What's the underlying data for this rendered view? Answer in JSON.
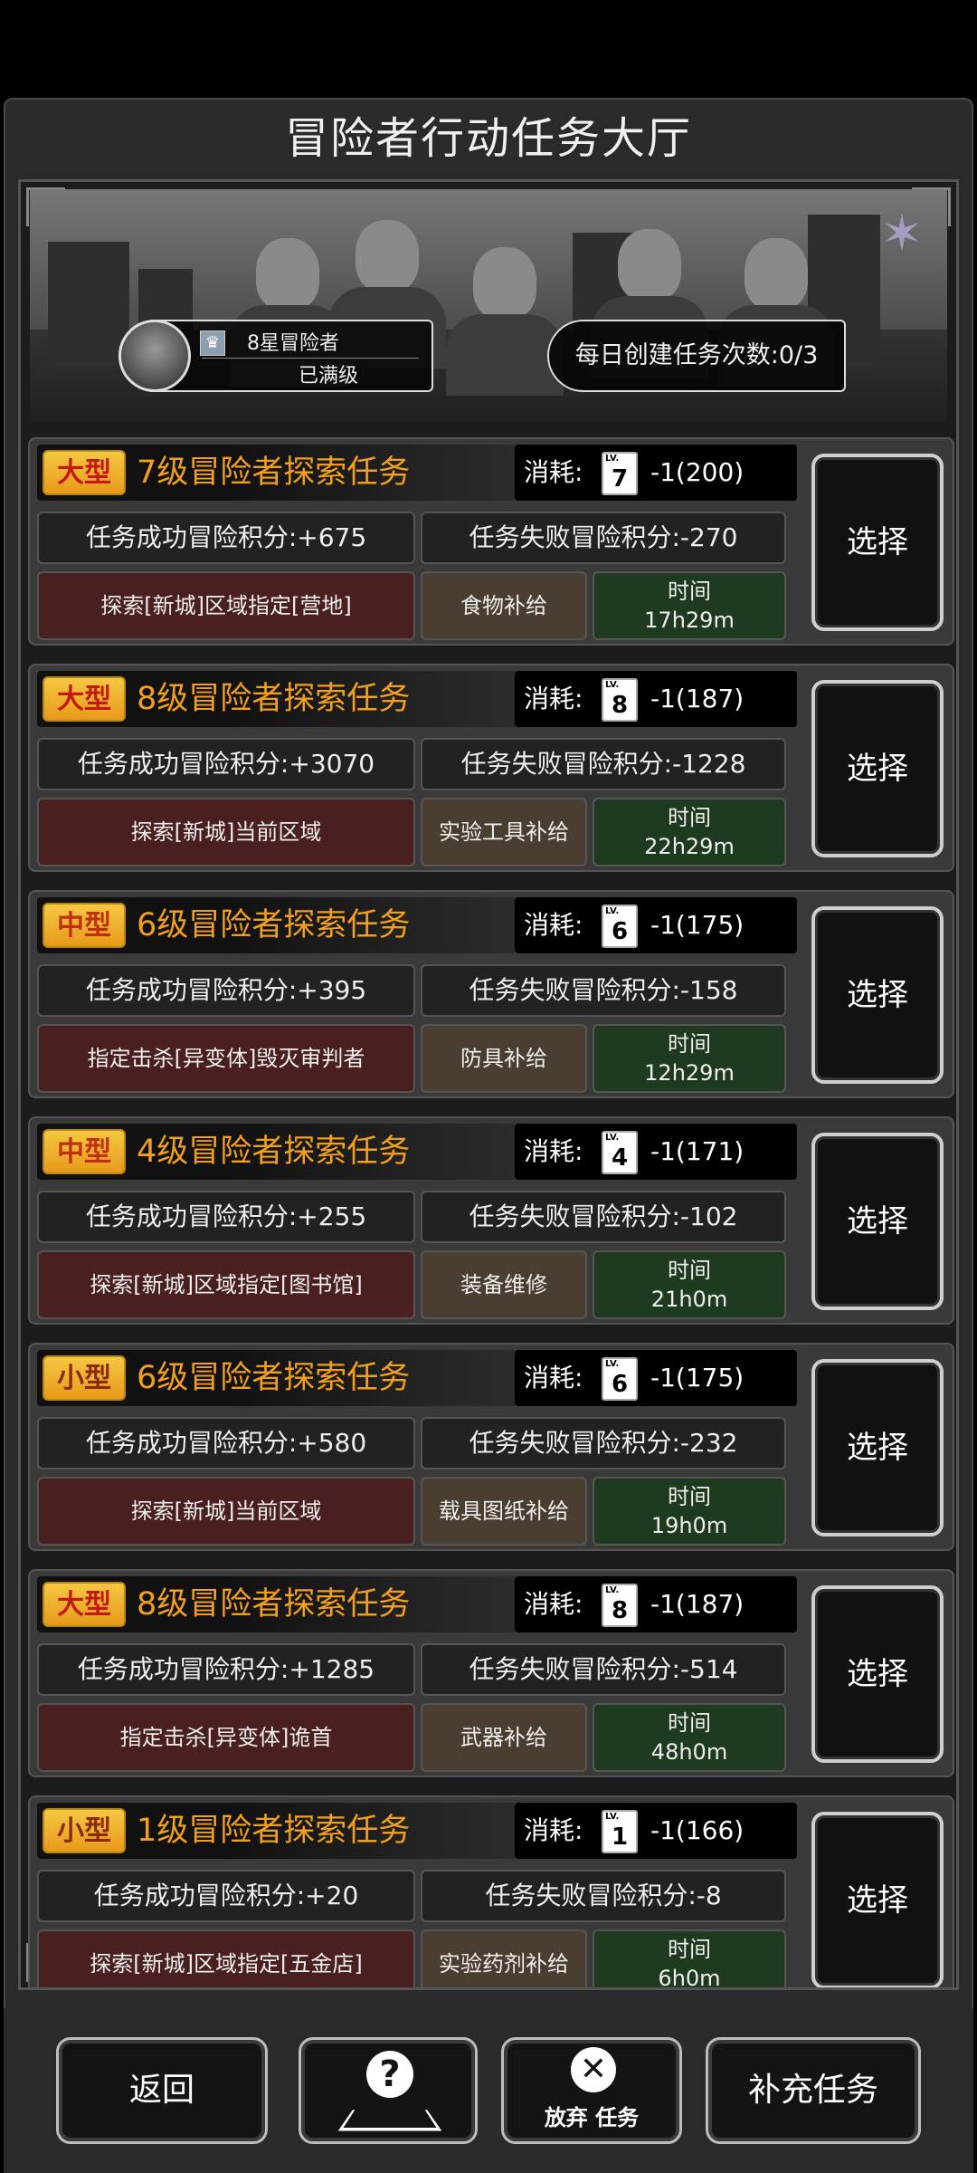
{
  "header": {
    "title": "冒险者行动任务大厅"
  },
  "player": {
    "rank_label": "8星冒险者",
    "status": "已满级"
  },
  "daily": {
    "text": "每日创建任务次数:0/3"
  },
  "common": {
    "cost_label": "消耗:",
    "select_label": "选择",
    "time_label": "时间",
    "lv_prefix": "LV."
  },
  "tasks": [
    {
      "size": "大型",
      "title": "7级冒险者探索任务",
      "lv": "7",
      "cost": "-1(200)",
      "success": "任务成功冒险积分:+675",
      "fail": "任务失败冒险积分:-270",
      "target": "探索[新城]区域指定[营地]",
      "reward": "食物补给",
      "time": "17h29m"
    },
    {
      "size": "大型",
      "title": "8级冒险者探索任务",
      "lv": "8",
      "cost": "-1(187)",
      "success": "任务成功冒险积分:+3070",
      "fail": "任务失败冒险积分:-1228",
      "target": "探索[新城]当前区域",
      "reward": "实验工具补给",
      "time": "22h29m"
    },
    {
      "size": "中型",
      "title": "6级冒险者探索任务",
      "lv": "6",
      "cost": "-1(175)",
      "success": "任务成功冒险积分:+395",
      "fail": "任务失败冒险积分:-158",
      "target": "指定击杀[异变体]毁灭审判者",
      "reward": "防具补给",
      "time": "12h29m"
    },
    {
      "size": "中型",
      "title": "4级冒险者探索任务",
      "lv": "4",
      "cost": "-1(171)",
      "success": "任务成功冒险积分:+255",
      "fail": "任务失败冒险积分:-102",
      "target": "探索[新城]区域指定[图书馆]",
      "reward": "装备维修",
      "time": "21h0m"
    },
    {
      "size": "小型",
      "title": "6级冒险者探索任务",
      "lv": "6",
      "cost": "-1(175)",
      "success": "任务成功冒险积分:+580",
      "fail": "任务失败冒险积分:-232",
      "target": "探索[新城]当前区域",
      "reward": "载具图纸补给",
      "time": "19h0m"
    },
    {
      "size": "大型",
      "title": "8级冒险者探索任务",
      "lv": "8",
      "cost": "-1(187)",
      "success": "任务成功冒险积分:+1285",
      "fail": "任务失败冒险积分:-514",
      "target": "指定击杀[异变体]诡首",
      "reward": "武器补给",
      "time": "48h0m"
    },
    {
      "size": "小型",
      "title": "1级冒险者探索任务",
      "lv": "1",
      "cost": "-1(166)",
      "success": "任务成功冒险积分:+20",
      "fail": "任务失败冒险积分:-8",
      "target": "探索[新城]区域指定[五金店]",
      "reward": "实验药剂补给",
      "time": "6h0m"
    }
  ],
  "bottom": {
    "back_label": "返回",
    "abandon_label": "放弃 任务",
    "refill_label": "补充任务"
  },
  "icons": {
    "help": "question-icon",
    "abandon": "close-icon",
    "emblem": "faction-emblem-icon",
    "rank": "crown-icon"
  },
  "colors": {
    "accent": "#f2a01a",
    "badge": "#f5c842",
    "big_text": "#c21a12",
    "target_bg": "#4a1f1f",
    "time_bg": "#1f3b1f"
  }
}
